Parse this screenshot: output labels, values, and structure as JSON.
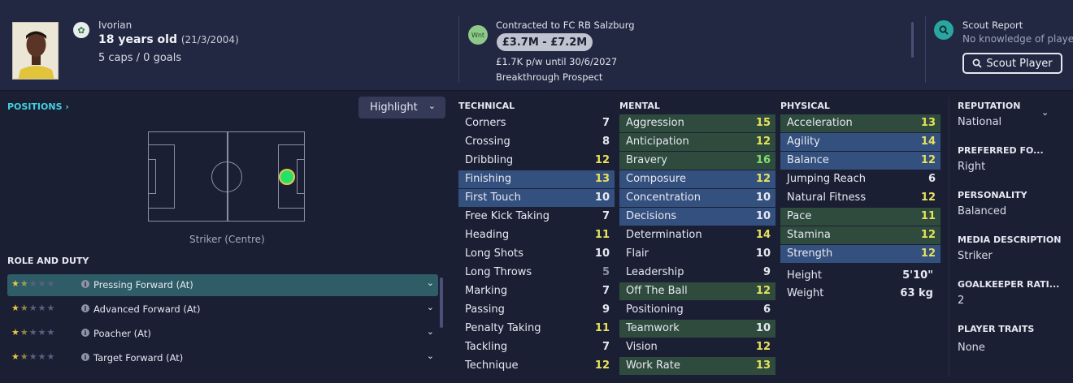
{
  "header": {
    "nationality": "Ivorian",
    "age": "18 years old",
    "dob": "(21/3/2004)",
    "caps": "5 caps / 0 goals",
    "wnt_label": "Wnt",
    "contract": "Contracted to FC RB Salzburg",
    "value": "£3.7M - £7.2M",
    "wage": "£1.7K p/w until 30/6/2027",
    "prospect": "Breakthrough Prospect",
    "scout_report_title": "Scout Report",
    "scout_report_sub": "No knowledge of player",
    "scout_button": "Scout Player"
  },
  "left": {
    "positions_label": "POSITIONS",
    "highlight_label": "Highlight",
    "position_name": "Striker (Centre)",
    "role_duty_title": "ROLE AND DUTY",
    "roles": [
      {
        "name": "Pressing Forward (At)",
        "stars": 1.5
      },
      {
        "name": "Advanced Forward (At)",
        "stars": 1.5
      },
      {
        "name": "Poacher (At)",
        "stars": 1.5
      },
      {
        "name": "Target Forward (At)",
        "stars": 1.5
      }
    ]
  },
  "technical": {
    "title": "TECHNICAL",
    "attrs": [
      {
        "name": "Corners",
        "value": "7"
      },
      {
        "name": "Crossing",
        "value": "8"
      },
      {
        "name": "Dribbling",
        "value": "12"
      },
      {
        "name": "Finishing",
        "value": "13"
      },
      {
        "name": "First Touch",
        "value": "10"
      },
      {
        "name": "Free Kick Taking",
        "value": "7"
      },
      {
        "name": "Heading",
        "value": "11"
      },
      {
        "name": "Long Shots",
        "value": "10"
      },
      {
        "name": "Long Throws",
        "value": "5"
      },
      {
        "name": "Marking",
        "value": "7"
      },
      {
        "name": "Passing",
        "value": "9"
      },
      {
        "name": "Penalty Taking",
        "value": "11"
      },
      {
        "name": "Tackling",
        "value": "7"
      },
      {
        "name": "Technique",
        "value": "12"
      }
    ]
  },
  "mental": {
    "title": "MENTAL",
    "attrs": [
      {
        "name": "Aggression",
        "value": "15"
      },
      {
        "name": "Anticipation",
        "value": "12"
      },
      {
        "name": "Bravery",
        "value": "16"
      },
      {
        "name": "Composure",
        "value": "12"
      },
      {
        "name": "Concentration",
        "value": "10"
      },
      {
        "name": "Decisions",
        "value": "10"
      },
      {
        "name": "Determination",
        "value": "14"
      },
      {
        "name": "Flair",
        "value": "10"
      },
      {
        "name": "Leadership",
        "value": "9"
      },
      {
        "name": "Off The Ball",
        "value": "12"
      },
      {
        "name": "Positioning",
        "value": "6"
      },
      {
        "name": "Teamwork",
        "value": "10"
      },
      {
        "name": "Vision",
        "value": "12"
      },
      {
        "name": "Work Rate",
        "value": "13"
      }
    ]
  },
  "physical": {
    "title": "PHYSICAL",
    "attrs": [
      {
        "name": "Acceleration",
        "value": "13"
      },
      {
        "name": "Agility",
        "value": "14"
      },
      {
        "name": "Balance",
        "value": "12"
      },
      {
        "name": "Jumping Reach",
        "value": "6"
      },
      {
        "name": "Natural Fitness",
        "value": "12"
      },
      {
        "name": "Pace",
        "value": "11"
      },
      {
        "name": "Stamina",
        "value": "12"
      },
      {
        "name": "Strength",
        "value": "12"
      }
    ],
    "height_label": "Height",
    "height_value": "5'10\"",
    "weight_label": "Weight",
    "weight_value": "63 kg"
  },
  "info": {
    "reputation_label": "REPUTATION",
    "reputation_value": "National",
    "foot_label": "PREFERRED FO...",
    "foot_value": "Right",
    "personality_label": "PERSONALITY",
    "personality_value": "Balanced",
    "media_label": "MEDIA DESCRIPTION",
    "media_value": "Striker",
    "gk_label": "GOALKEEPER RATI...",
    "gk_value": "2",
    "traits_label": "PLAYER TRAITS",
    "traits_value": "None"
  }
}
